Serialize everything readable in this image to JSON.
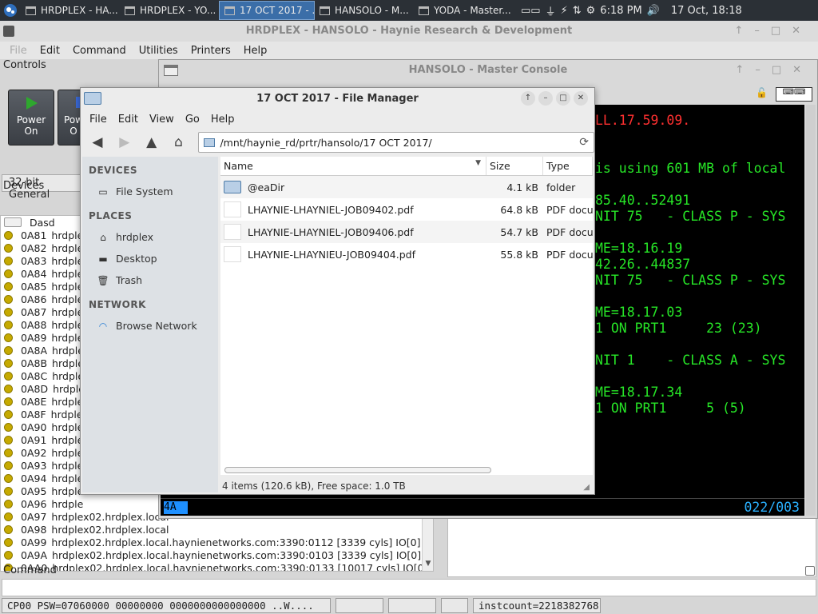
{
  "taskbar": {
    "tasks": [
      "HRDPLEX - HA...",
      "HRDPLEX - YO...",
      "17 OCT 2017 - ...",
      "HANSOLO - M...",
      "YODA - Master..."
    ],
    "clock": "6:18 PM",
    "date": "17 Oct, 18:18"
  },
  "herc": {
    "title": "HRDPLEX - HANSOLO - Haynie Research & Development",
    "menu": [
      "File",
      "Edit",
      "Command",
      "Utilities",
      "Printers",
      "Help"
    ],
    "controls_label": "Controls",
    "power_on": "Power\nOn",
    "power_off": "Pow\nO",
    "mode": "32-bit General",
    "devices_label": "Devices",
    "devices": [
      {
        "id": "Dasd",
        "text": "",
        "type": "dasd"
      },
      {
        "id": "0A81",
        "text": "hrdple",
        "type": "led"
      },
      {
        "id": "0A82",
        "text": "hrdple",
        "type": "led"
      },
      {
        "id": "0A83",
        "text": "hrdple",
        "type": "led"
      },
      {
        "id": "0A84",
        "text": "hrdple",
        "type": "led"
      },
      {
        "id": "0A85",
        "text": "hrdple",
        "type": "led"
      },
      {
        "id": "0A86",
        "text": "hrdple",
        "type": "led"
      },
      {
        "id": "0A87",
        "text": "hrdple",
        "type": "led"
      },
      {
        "id": "0A88",
        "text": "hrdple",
        "type": "led"
      },
      {
        "id": "0A89",
        "text": "hrdple",
        "type": "led"
      },
      {
        "id": "0A8A",
        "text": "hrdple",
        "type": "led"
      },
      {
        "id": "0A8B",
        "text": "hrdple",
        "type": "led"
      },
      {
        "id": "0A8C",
        "text": "hrdple",
        "type": "led"
      },
      {
        "id": "0A8D",
        "text": "hrdple",
        "type": "led"
      },
      {
        "id": "0A8E",
        "text": "hrdple",
        "type": "led"
      },
      {
        "id": "0A8F",
        "text": "hrdple",
        "type": "led"
      },
      {
        "id": "0A90",
        "text": "hrdple",
        "type": "led"
      },
      {
        "id": "0A91",
        "text": "hrdple",
        "type": "led"
      },
      {
        "id": "0A92",
        "text": "hrdple",
        "type": "led"
      },
      {
        "id": "0A93",
        "text": "hrdple",
        "type": "led"
      },
      {
        "id": "0A94",
        "text": "hrdple",
        "type": "led"
      },
      {
        "id": "0A95",
        "text": "hrdple",
        "type": "led"
      },
      {
        "id": "0A96",
        "text": "hrdple",
        "type": "led"
      },
      {
        "id": "0A97",
        "text": "hrdplex02.hrdplex.local",
        "type": "led"
      },
      {
        "id": "0A98",
        "text": "hrdplex02.hrdplex.local",
        "type": "led"
      },
      {
        "id": "0A99",
        "text": "hrdplex02.hrdplex.local.haynienetworks.com:3390:0112 [3339 cyls] IO[0]",
        "type": "led"
      },
      {
        "id": "0A9A",
        "text": "hrdplex02.hrdplex.local.haynienetworks.com:3390:0103 [3339 cyls] IO[0]",
        "type": "led"
      },
      {
        "id": "0AA0",
        "text": "hrdplex02.hrdplex.local.haynienetworks.com:3390:0133 [10017 cyls] IO[0]",
        "type": "led"
      }
    ],
    "command_label": "Command",
    "status": [
      "CP00 PSW=07060000 00000000 0000000000000000 ..W....",
      "",
      "",
      "",
      "instcount=2218382768"
    ]
  },
  "console": {
    "title": "HANSOLO - Master Console",
    "lines": [
      {
        "text": "LL.17.59.09.",
        "color": "red"
      },
      {
        "text": "",
        "color": "green"
      },
      {
        "text": "",
        "color": "green"
      },
      {
        "text": "is using 601 MB of local",
        "color": "green"
      },
      {
        "text": "",
        "color": "green"
      },
      {
        "text": "85.40..52491",
        "color": "green"
      },
      {
        "text": "NIT 75   - CLASS P - SYS",
        "color": "green"
      },
      {
        "text": "",
        "color": "green"
      },
      {
        "text": "ME=18.16.19",
        "color": "green"
      },
      {
        "text": "42.26..44837",
        "color": "green"
      },
      {
        "text": "NIT 75   - CLASS P - SYS",
        "color": "green"
      },
      {
        "text": "",
        "color": "green"
      },
      {
        "text": "ME=18.17.03",
        "color": "green"
      },
      {
        "text": "1 ON PRT1     23 (23)",
        "color": "green"
      },
      {
        "text": "",
        "color": "green"
      },
      {
        "text": "NIT 1    - CLASS A - SYS",
        "color": "green"
      },
      {
        "text": "",
        "color": "green"
      },
      {
        "text": "ME=18.17.34",
        "color": "green"
      },
      {
        "text": "1 ON PRT1     5 (5)",
        "color": "green"
      }
    ],
    "cursor_text": "4A",
    "position": "022/003"
  },
  "fm": {
    "title": "17 OCT 2017 - File Manager",
    "menu": [
      "File",
      "Edit",
      "View",
      "Go",
      "Help"
    ],
    "path": "/mnt/haynie_rd/prtr/hansolo/17 OCT 2017/",
    "sidebar": {
      "devices_header": "DEVICES",
      "filesystem": "File System",
      "places_header": "PLACES",
      "places": [
        "hrdplex",
        "Desktop",
        "Trash"
      ],
      "network_header": "NETWORK",
      "browse": "Browse Network"
    },
    "columns": {
      "name": "Name",
      "size": "Size",
      "type": "Type"
    },
    "files": [
      {
        "name": "@eaDir",
        "size": "4.1 kB",
        "type": "folder",
        "kind": "folder"
      },
      {
        "name": "LHAYNIE-LHAYNIEL-JOB09402.pdf",
        "size": "64.8 kB",
        "type": "PDF docum",
        "kind": "pdf"
      },
      {
        "name": "LHAYNIE-LHAYNIEL-JOB09406.pdf",
        "size": "54.7 kB",
        "type": "PDF docum",
        "kind": "pdf"
      },
      {
        "name": "LHAYNIE-LHAYNIEU-JOB09404.pdf",
        "size": "55.8 kB",
        "type": "PDF docum",
        "kind": "pdf"
      }
    ],
    "status": "4 items (120.6 kB), Free space: 1.0 TB"
  },
  "colors": {
    "console_green": "#27e627",
    "console_red": "#ff3030",
    "led_yellow": "#c6aa00",
    "task_active": "#3b6ea8"
  }
}
